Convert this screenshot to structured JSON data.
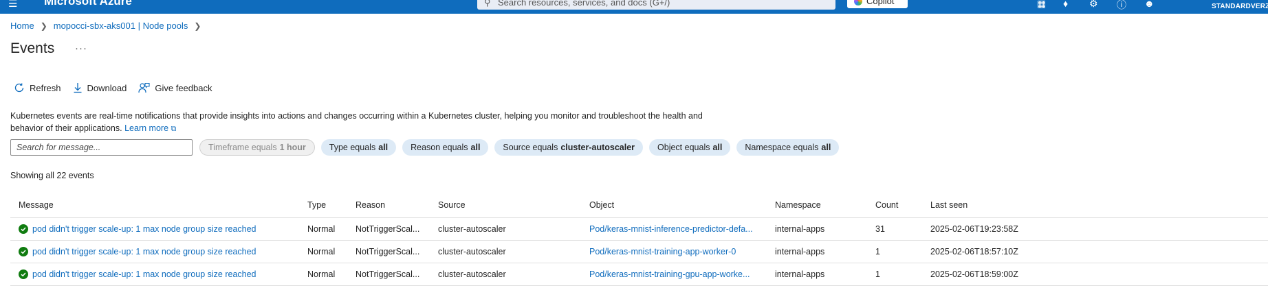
{
  "topbar": {
    "menu_icon": "hamburger-icon",
    "brand": "Microsoft Azure",
    "search_placeholder": "Search resources, services, and docs (G+/)",
    "copilot_label": "Copilot",
    "icons": [
      "cloud-shell-icon",
      "notifications-icon",
      "settings-icon",
      "help-icon",
      "feedback-icon"
    ],
    "account_label": "STANDARDVERZEE"
  },
  "breadcrumb": {
    "items": [
      "Home",
      "mopocci-sbx-aks001 | Node pools"
    ]
  },
  "page": {
    "title": "Events",
    "more": "···"
  },
  "toolbar": {
    "refresh": "Refresh",
    "download": "Download",
    "feedback": "Give feedback"
  },
  "description": {
    "text": "Kubernetes events are real-time notifications that provide insights into actions and changes occurring within a Kubernetes cluster, helping you monitor and troubleshoot the health and behavior of their applications.",
    "link": "Learn more"
  },
  "filters": {
    "search_placeholder": "Search for message...",
    "pills": [
      {
        "label": "Timeframe equals",
        "value": "1 hour",
        "disabled": true
      },
      {
        "label": "Type equals",
        "value": "all",
        "disabled": false
      },
      {
        "label": "Reason equals",
        "value": "all",
        "disabled": false
      },
      {
        "label": "Source equals",
        "value": "cluster-autoscaler",
        "disabled": false
      },
      {
        "label": "Object equals",
        "value": "all",
        "disabled": false
      },
      {
        "label": "Namespace equals",
        "value": "all",
        "disabled": false
      }
    ]
  },
  "summary": "Showing all 22 events",
  "table": {
    "columns": [
      "Message",
      "Type",
      "Reason",
      "Source",
      "Object",
      "Namespace",
      "Count",
      "Last seen"
    ],
    "rows": [
      {
        "message": "pod didn't trigger scale-up: 1 max node group size reached",
        "type": "Normal",
        "reason": "NotTriggerScal...",
        "source": "cluster-autoscaler",
        "object": "Pod/keras-mnist-inference-predictor-defa...",
        "namespace": "internal-apps",
        "count": "31",
        "last_seen": "2025-02-06T19:23:58Z"
      },
      {
        "message": "pod didn't trigger scale-up: 1 max node group size reached",
        "type": "Normal",
        "reason": "NotTriggerScal...",
        "source": "cluster-autoscaler",
        "object": "Pod/keras-mnist-training-app-worker-0",
        "namespace": "internal-apps",
        "count": "1",
        "last_seen": "2025-02-06T18:57:10Z"
      },
      {
        "message": "pod didn't trigger scale-up: 1 max node group size reached",
        "type": "Normal",
        "reason": "NotTriggerScal...",
        "source": "cluster-autoscaler",
        "object": "Pod/keras-mnist-training-gpu-app-worke...",
        "namespace": "internal-apps",
        "count": "1",
        "last_seen": "2025-02-06T18:59:00Z"
      }
    ]
  },
  "colors": {
    "brand_blue": "#0f6cbd",
    "success_green": "#107c10",
    "pill_bg": "#ddeaf6"
  }
}
